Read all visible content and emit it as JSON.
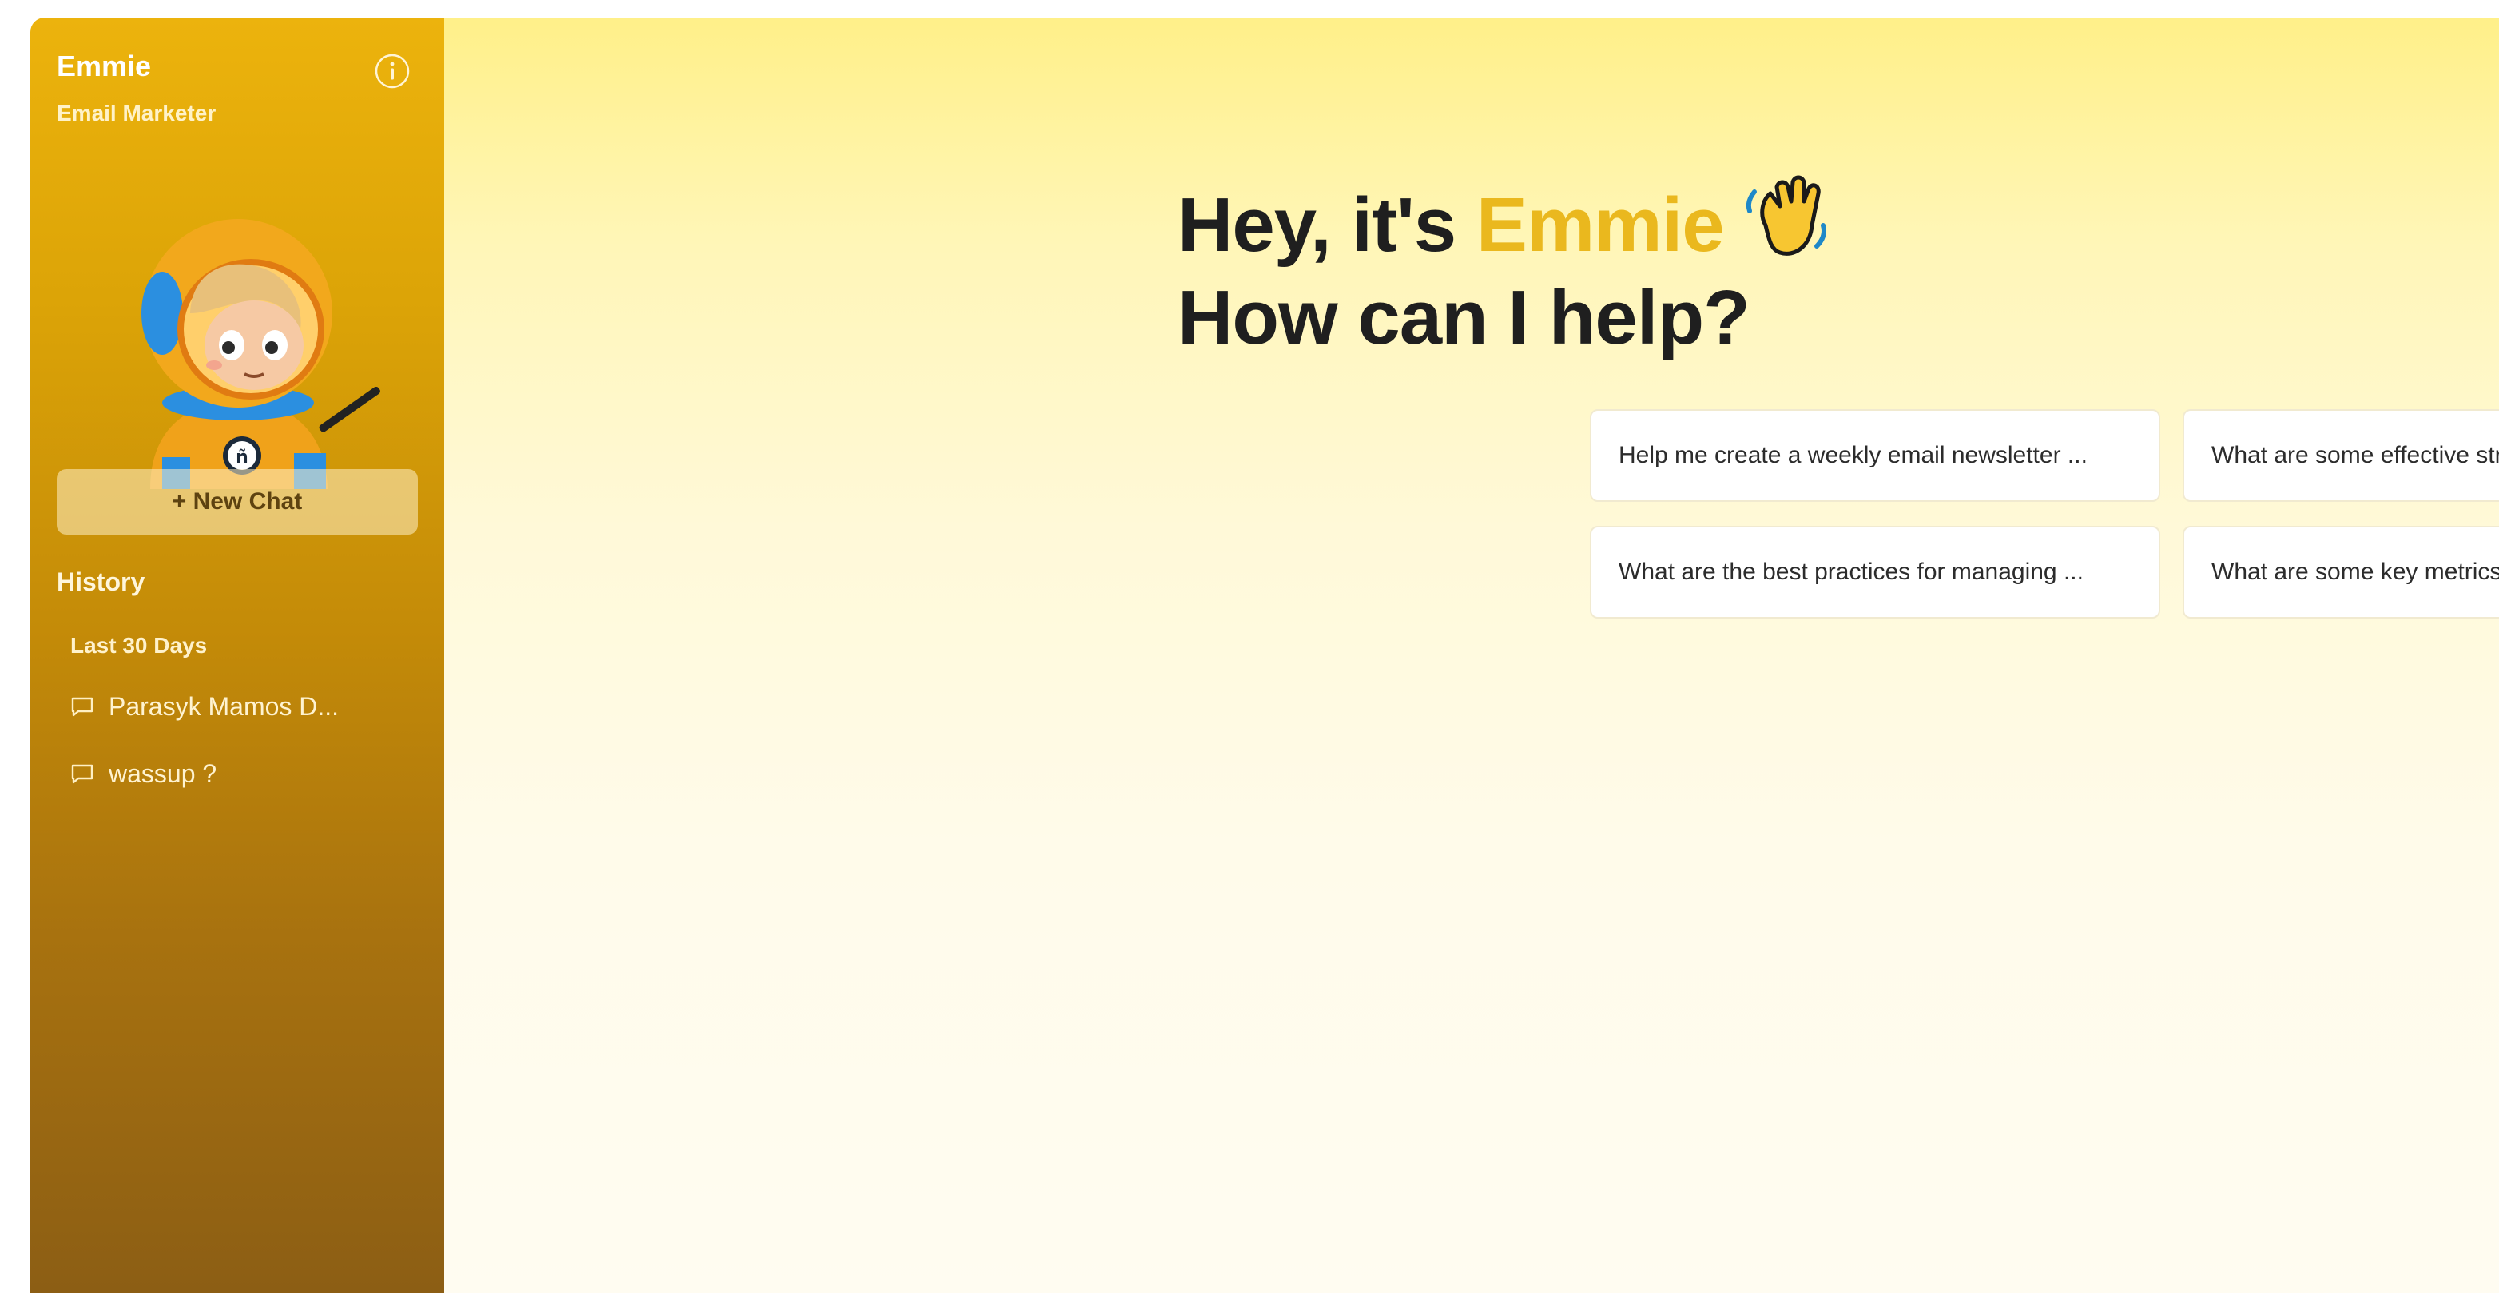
{
  "sidebar": {
    "agent_name": "Emmie",
    "agent_role": "Email Marketer",
    "avatar_icon": "astronaut-avatar-icon",
    "new_chat_label": "+ New Chat",
    "history_title": "History",
    "history_group": "Last 30 Days",
    "history_items": [
      {
        "label": "Parasyk Mamos D...",
        "icon": "chat-bubble-icon"
      },
      {
        "label": "wassup ?",
        "icon": "chat-bubble-icon"
      }
    ],
    "colors": {
      "top": "#ecb30d",
      "bottom": "#8c5e14"
    }
  },
  "main": {
    "greeting_prefix": "Hey, it's ",
    "greeting_name": "Emmie",
    "greeting_line2": "How can I help?",
    "wave_icon": "waving-hand-icon",
    "accent_color": "#eab81e",
    "suggestions": [
      "Help me create a weekly email newsletter ...",
      "What are some effective strategies to incr...",
      "What are the best practices for managing ...",
      "What are some key metrics I should track t..."
    ]
  }
}
